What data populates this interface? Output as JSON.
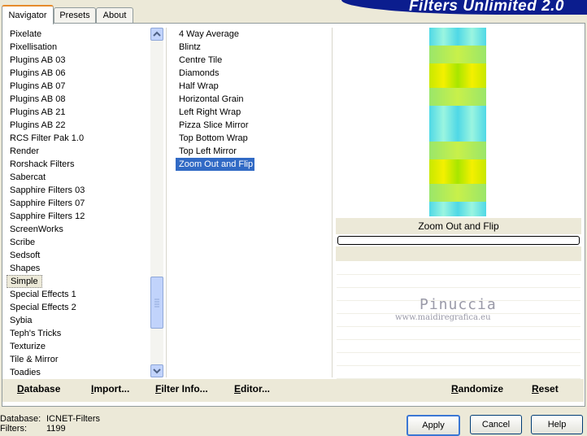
{
  "tabs": [
    {
      "label": "Navigator"
    },
    {
      "label": "Presets"
    },
    {
      "label": "About"
    }
  ],
  "banner": {
    "title": "Filters Unlimited 2.0"
  },
  "categories": [
    "Pixelate",
    "Pixellisation",
    "Plugins AB 03",
    "Plugins AB 06",
    "Plugins AB 07",
    "Plugins AB 08",
    "Plugins AB 21",
    "Plugins AB 22",
    "RCS Filter Pak 1.0",
    "Render",
    "Rorshack Filters",
    "Sabercat",
    "Sapphire Filters 03",
    "Sapphire Filters 07",
    "Sapphire Filters 12",
    "ScreenWorks",
    "Scribe",
    "Sedsoft",
    "Shapes",
    "Simple",
    "Special Effects 1",
    "Special Effects 2",
    "Sybia",
    "Teph's Tricks",
    "Texturize",
    "Tile & Mirror",
    "Toadies"
  ],
  "selected_category": "Simple",
  "filters": [
    "4 Way Average",
    "Blintz",
    "Centre Tile",
    "Diamonds",
    "Half Wrap",
    "Horizontal Grain",
    "Left Right Wrap",
    "Pizza Slice Mirror",
    "Top Bottom Wrap",
    "Top Left Mirror",
    "Zoom Out and Flip"
  ],
  "selected_filter": "Zoom Out and Flip",
  "preview": {
    "filter_name": "Zoom Out and Flip",
    "progress": 0
  },
  "watermark": {
    "name": "Pinuccia",
    "url": "www.maidiregrafica.eu"
  },
  "bottom_left_buttons": {
    "database": "Database",
    "import": "Import...",
    "filter_info": "Filter Info...",
    "editor": "Editor..."
  },
  "bottom_right_buttons": {
    "randomize": "Randomize",
    "reset": "Reset"
  },
  "status": {
    "database_label": "Database:",
    "database_value": "ICNET-Filters",
    "filters_label": "Filters:",
    "filters_value": "1199"
  },
  "actions": {
    "apply": "Apply",
    "cancel": "Cancel",
    "help": "Help"
  },
  "colors": {
    "selection": "#316ac5",
    "banner": "#0b1d8e",
    "preview_cyan": "#7ee8e0",
    "preview_yellow": "#e8f000"
  }
}
